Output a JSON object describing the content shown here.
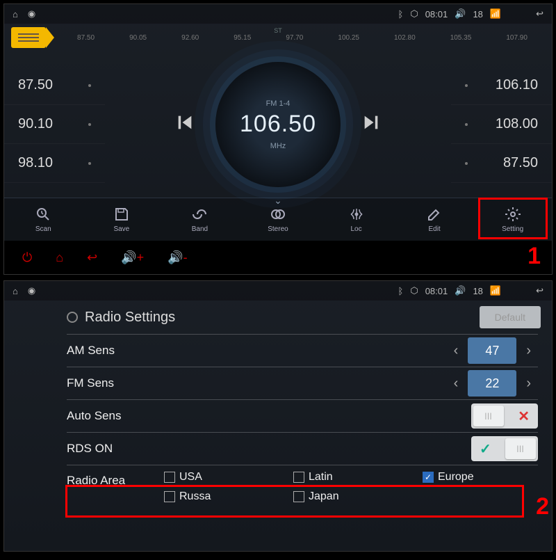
{
  "statusbar": {
    "time": "08:01",
    "volume_level": "18"
  },
  "radio": {
    "scale_ticks": [
      "87.50",
      "90.05",
      "92.60",
      "95.15",
      "97.70",
      "100.25",
      "102.80",
      "105.35",
      "107.90"
    ],
    "band_label": "FM 1-4",
    "frequency": "106.50",
    "unit": "MHz",
    "stereo_label": "ST",
    "presets_left": [
      "87.50",
      "90.10",
      "98.10"
    ],
    "presets_right": [
      "106.10",
      "108.00",
      "87.50"
    ]
  },
  "toolbar": {
    "scan": "Scan",
    "save": "Save",
    "band": "Band",
    "stereo": "Stereo",
    "loc": "Loc",
    "edit": "Edit",
    "setting": "Setting"
  },
  "settings": {
    "title": "Radio Settings",
    "default_btn": "Default",
    "am_sens_label": "AM Sens",
    "am_sens_value": "47",
    "fm_sens_label": "FM Sens",
    "fm_sens_value": "22",
    "auto_sens_label": "Auto Sens",
    "rds_on_label": "RDS ON",
    "radio_area_label": "Radio Area",
    "areas": [
      {
        "label": "USA",
        "checked": false
      },
      {
        "label": "Latin",
        "checked": false
      },
      {
        "label": "Europe",
        "checked": true
      },
      {
        "label": "Russa",
        "checked": false
      },
      {
        "label": "Japan",
        "checked": false
      }
    ]
  },
  "annotations": {
    "step1": "1",
    "step2": "2"
  }
}
